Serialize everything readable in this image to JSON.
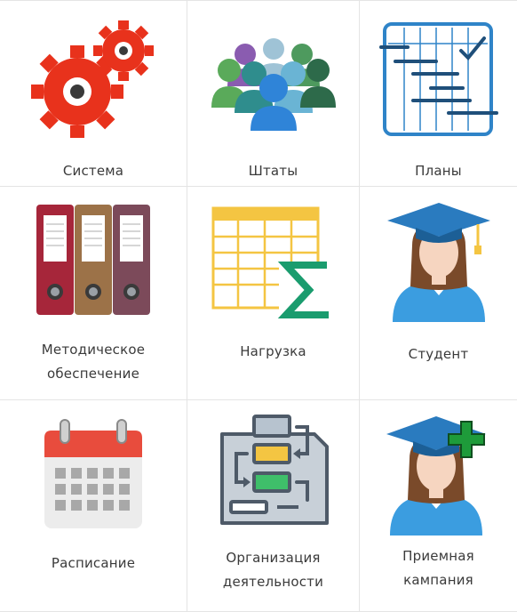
{
  "tiles": [
    {
      "id": "sistema",
      "label_lines": [
        "Система"
      ],
      "icon": "gears-icon"
    },
    {
      "id": "shtaty",
      "label_lines": [
        "Штаты"
      ],
      "icon": "staff-group-icon"
    },
    {
      "id": "plany",
      "label_lines": [
        "Планы"
      ],
      "icon": "plan-chart-icon"
    },
    {
      "id": "metodicheskoe",
      "label_lines": [
        "Методическое",
        "обеспечение"
      ],
      "icon": "binders-icon"
    },
    {
      "id": "nagruzka",
      "label_lines": [
        "Нагрузка"
      ],
      "icon": "spreadsheet-sum-icon"
    },
    {
      "id": "student",
      "label_lines": [
        "Студент"
      ],
      "icon": "graduate-student-icon"
    },
    {
      "id": "raspisanie",
      "label_lines": [
        "Расписание"
      ],
      "icon": "calendar-icon"
    },
    {
      "id": "organizatsiya",
      "label_lines": [
        "Организация",
        "деятельности"
      ],
      "icon": "workflow-flowchart-icon"
    },
    {
      "id": "priemnaya",
      "label_lines": [
        "Приемная",
        "кампания"
      ],
      "icon": "graduate-add-icon"
    }
  ],
  "colors": {
    "gear_red": "#e8321c",
    "plan_blue": "#2f84c8",
    "binder_red": "#a6263a",
    "binder_brown": "#9c7248",
    "binder_plum": "#7c4a5a",
    "sheet_yellow": "#f4c542",
    "sum_green": "#1a9c6e",
    "cap_blue": "#2a7bbf",
    "student_blue": "#3b9de0",
    "calendar_red": "#e84c3d",
    "flow_gray": "#5d6a7a",
    "plus_green": "#1e9b3a"
  }
}
